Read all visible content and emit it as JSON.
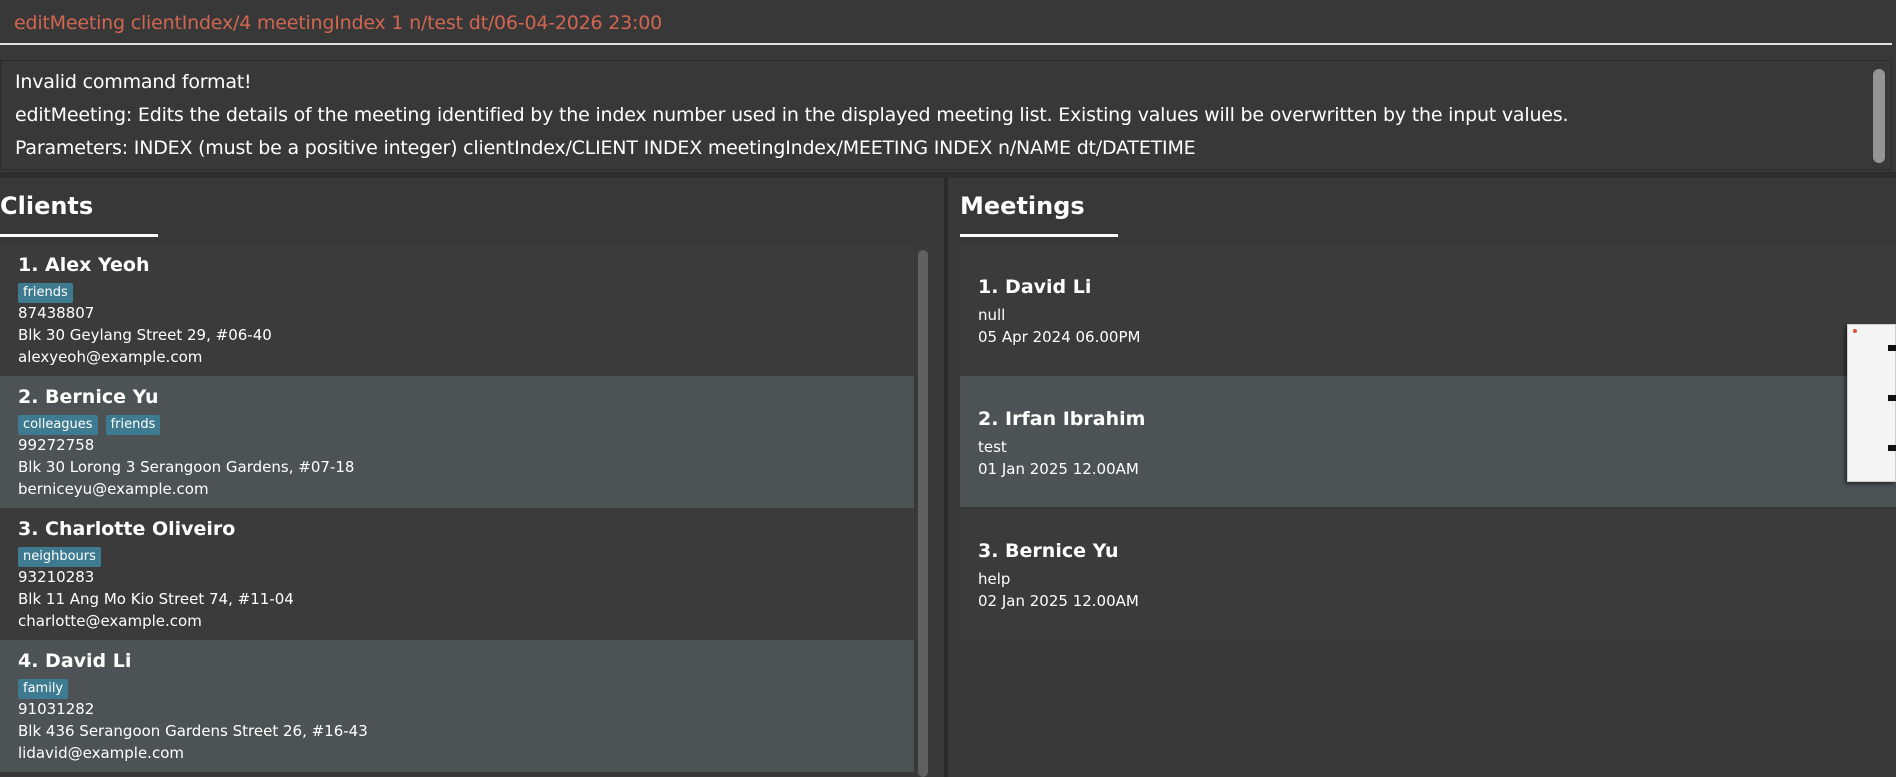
{
  "command": {
    "value": "editMeeting clientIndex/4 meetingIndex 1 n/test dt/06-04-2026 23:00"
  },
  "result": {
    "lines": [
      "Invalid command format!",
      "editMeeting: Edits the details of the meeting identified by the index number used in the displayed meeting list. Existing values will be overwritten by the input values.",
      "Parameters: INDEX (must be a positive integer) clientIndex/CLIENT INDEX meetingIndex/MEETING INDEX n/NAME dt/DATETIME"
    ]
  },
  "clients": {
    "title": "Clients",
    "items": [
      {
        "name": "1.  Alex Yeoh",
        "tags": [
          "friends"
        ],
        "phone": "87438807",
        "address": "Blk 30 Geylang Street 29, #06-40",
        "email": "alexyeoh@example.com"
      },
      {
        "name": "2.  Bernice Yu",
        "tags": [
          "colleagues",
          "friends"
        ],
        "phone": "99272758",
        "address": "Blk 30 Lorong 3 Serangoon Gardens, #07-18",
        "email": "berniceyu@example.com"
      },
      {
        "name": "3.  Charlotte Oliveiro",
        "tags": [
          "neighbours"
        ],
        "phone": "93210283",
        "address": "Blk 11 Ang Mo Kio Street 74, #11-04",
        "email": "charlotte@example.com"
      },
      {
        "name": "4.  David Li",
        "tags": [
          "family"
        ],
        "phone": "91031282",
        "address": "Blk 436 Serangoon Gardens Street 26, #16-43",
        "email": "lidavid@example.com"
      }
    ]
  },
  "meetings": {
    "title": "Meetings",
    "items": [
      {
        "name": "1.  David Li",
        "title": "null",
        "datetime": "05 Apr 2024 06.00PM"
      },
      {
        "name": "2.  Irfan Ibrahim",
        "title": "test",
        "datetime": "01 Jan 2025 12.00AM"
      },
      {
        "name": "3.  Bernice Yu",
        "title": "help",
        "datetime": "02 Jan 2025 12.00AM"
      }
    ]
  },
  "colors": {
    "background": "#383838",
    "command_text": "#d06651",
    "tag": "#3e7b91",
    "card_dark": "#3b3b3b",
    "card_light": "#4d5254"
  }
}
